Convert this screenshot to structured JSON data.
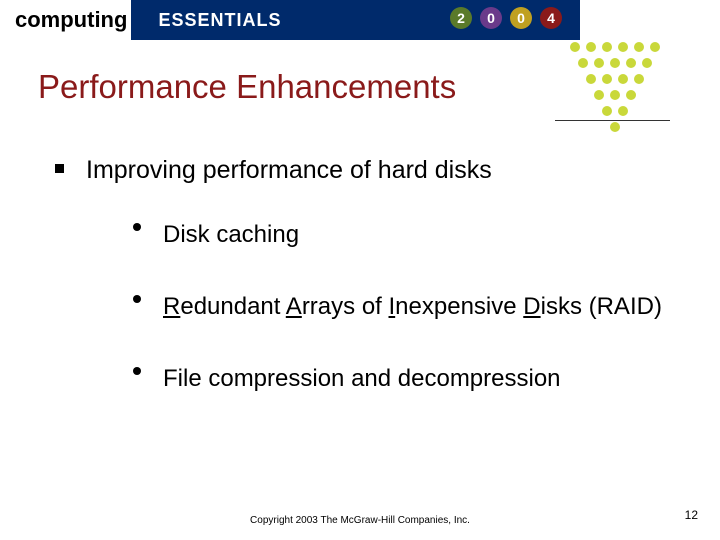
{
  "header": {
    "brand1": "computing",
    "brand2": "ESSENTIALS",
    "year": [
      "2",
      "0",
      "0",
      "4"
    ]
  },
  "title": "Performance Enhancements",
  "main": {
    "bullet": "Improving performance of hard disks",
    "subs": {
      "a": "Disk caching",
      "b_r": "R",
      "b_t1": "edundant ",
      "b_a": "A",
      "b_t2": "rrays of ",
      "b_i": "I",
      "b_t3": "nexpensive ",
      "b_d": "D",
      "b_t4": "isks (RAID)",
      "c": "File compression and decompression"
    }
  },
  "footer": {
    "copyright": "Copyright 2003 The McGraw-Hill Companies, Inc.",
    "page": "12"
  }
}
